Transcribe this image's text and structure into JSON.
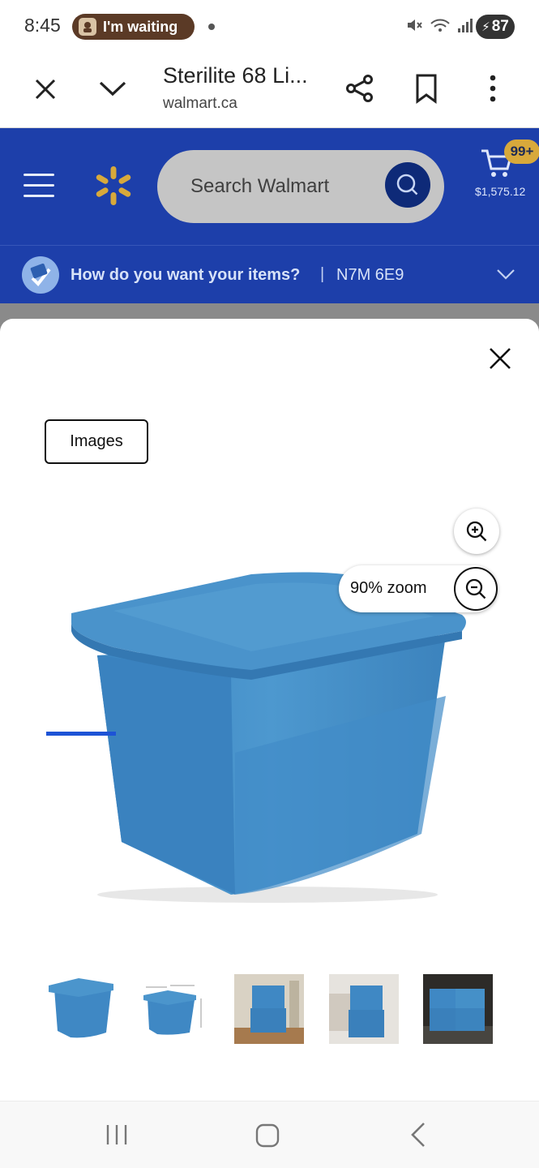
{
  "status_bar": {
    "time": "8:45",
    "notification_label": "I'm waiting",
    "battery": "87",
    "icons": [
      "mute-icon",
      "wifi-icon",
      "signal-icon",
      "battery-icon"
    ]
  },
  "tab_toolbar": {
    "title": "Sterilite 68 Li...",
    "url": "walmart.ca",
    "icons": [
      "close-icon",
      "chevron-down-icon",
      "share-icon",
      "bookmark-icon",
      "more-icon"
    ]
  },
  "walmart_header": {
    "search_placeholder": "Search Walmart",
    "cart_badge": "99+",
    "cart_total": "$1,575.12",
    "brand_color": "#1d3faa",
    "spark_color": "#d8a93b"
  },
  "delivery": {
    "question": "How do you want your items?",
    "separator": "|",
    "postal_code": "N7M 6E9"
  },
  "modal": {
    "tab_label": "Images",
    "zoom_label": "90% zoom",
    "zoom_level_percent": 90,
    "selected_thumbnail_index": 0,
    "product_color": "#4a90c6",
    "thumbnails": [
      {
        "name": "thumbnail-bin-front"
      },
      {
        "name": "thumbnail-bin-dimensions"
      },
      {
        "name": "thumbnail-stacked-room"
      },
      {
        "name": "thumbnail-bin-bedroom"
      },
      {
        "name": "thumbnail-stacked-bins"
      }
    ]
  },
  "nav_bar": {
    "icons": [
      "recents-icon",
      "home-icon",
      "back-icon"
    ]
  }
}
